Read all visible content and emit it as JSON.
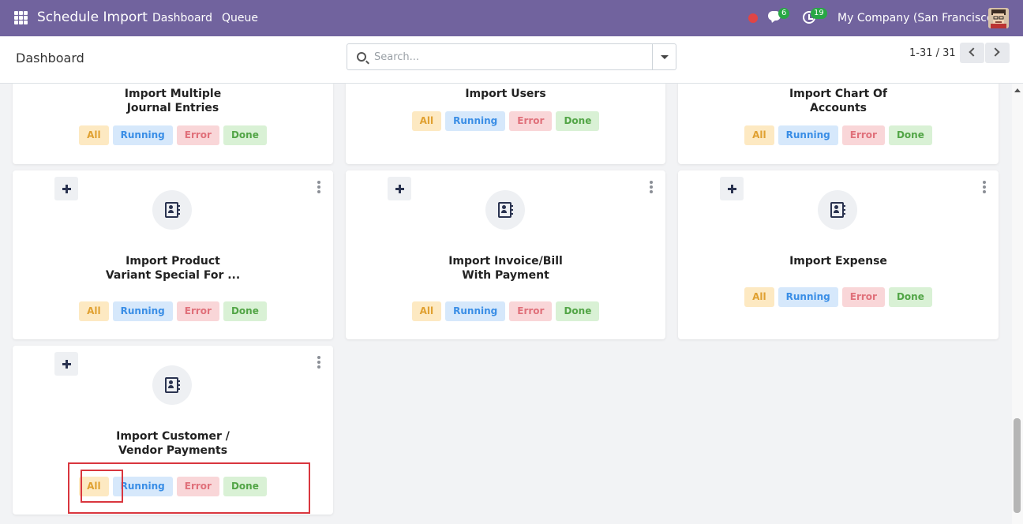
{
  "navbar": {
    "app_name": "Schedule Import",
    "menu": [
      "Dashboard",
      "Queue"
    ],
    "messages_count": "6",
    "activities_count": "19",
    "company": "My Company (San Francisco)"
  },
  "control_panel": {
    "title": "Dashboard",
    "search_placeholder": "Search...",
    "pager": "1-31 / 31"
  },
  "filters": [
    "All",
    "Running",
    "Error",
    "Done"
  ],
  "cards": [
    {
      "title_lines": [
        "Import Multiple",
        "Journal Entries"
      ]
    },
    {
      "title_lines": [
        "Import Users"
      ]
    },
    {
      "title_lines": [
        "Import Chart Of",
        "Accounts"
      ]
    },
    {
      "title_lines": [
        "Import Product",
        "Variant Special For ..."
      ]
    },
    {
      "title_lines": [
        "Import Invoice/Bill",
        "With Payment"
      ]
    },
    {
      "title_lines": [
        "Import Expense"
      ]
    },
    {
      "title_lines": [
        "Import Customer /",
        "Vendor Payments"
      ]
    }
  ],
  "colors": {
    "navbar": "#71639e",
    "highlight": "#d9363e"
  }
}
